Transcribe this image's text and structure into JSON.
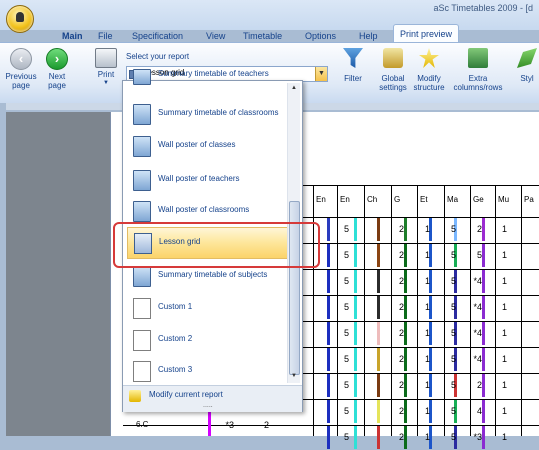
{
  "window": {
    "title": "aSc Timetables 2009 - [d"
  },
  "tabs": [
    {
      "label": "Main"
    },
    {
      "label": "File"
    },
    {
      "label": "Specification"
    },
    {
      "label": "View"
    },
    {
      "label": "Timetable"
    },
    {
      "label": "Options"
    },
    {
      "label": "Help"
    },
    {
      "label": "Print preview"
    }
  ],
  "ribbon": {
    "previous": "Previous page",
    "next": "Next page",
    "print": "Print",
    "report_label": "Select your report",
    "report_value": "Lesson grid",
    "filter": "Filter",
    "global_settings": "Global settings",
    "modify_structure": "Modify structure",
    "extra": "Extra columns/rows",
    "style": "Styl"
  },
  "menu": {
    "items": [
      {
        "label": "Summary timetable of teachers"
      },
      {
        "label": "Summary timetable of classrooms"
      },
      {
        "label": "Wall poster of classes"
      },
      {
        "label": "Wall poster of teachers"
      },
      {
        "label": "Wall poster of classrooms"
      },
      {
        "label": "Lesson grid"
      },
      {
        "label": "Summary timetable of subjects"
      },
      {
        "label": "Custom 1"
      },
      {
        "label": "Custom 2"
      },
      {
        "label": "Custom 3"
      }
    ],
    "footer": "Modify current report",
    "grip": "....."
  },
  "grid": {
    "headers": [
      "En",
      "En",
      "Ch",
      "G",
      "Et",
      "Ma",
      "Ge",
      "Mu",
      "Pa"
    ],
    "rows": [
      {
        "vals": [
          "5",
          "2",
          "1",
          "5",
          "2",
          "1"
        ]
      },
      {
        "vals": [
          "5",
          "2",
          "1",
          "5",
          "5",
          "1"
        ]
      },
      {
        "vals": [
          "5",
          "2",
          "1",
          "5",
          "*4",
          "1"
        ]
      },
      {
        "vals": [
          "5",
          "2",
          "1",
          "5",
          "*4",
          "1"
        ]
      },
      {
        "vals": [
          "5",
          "2",
          "1",
          "5",
          "*4",
          "1"
        ]
      },
      {
        "vals": [
          "5",
          "2",
          "1",
          "5",
          "*4",
          "1"
        ]
      },
      {
        "vals": [
          "5",
          "2",
          "1",
          "5",
          "2",
          "1"
        ]
      },
      {
        "vals": [
          "5",
          "2",
          "1",
          "5",
          "4",
          "1"
        ]
      },
      {
        "vals": [
          "5",
          "2",
          "1",
          "5",
          "*3",
          "1"
        ]
      }
    ],
    "last_row_label": "6.C",
    "last_row_extra": [
      "*3",
      "2"
    ]
  }
}
